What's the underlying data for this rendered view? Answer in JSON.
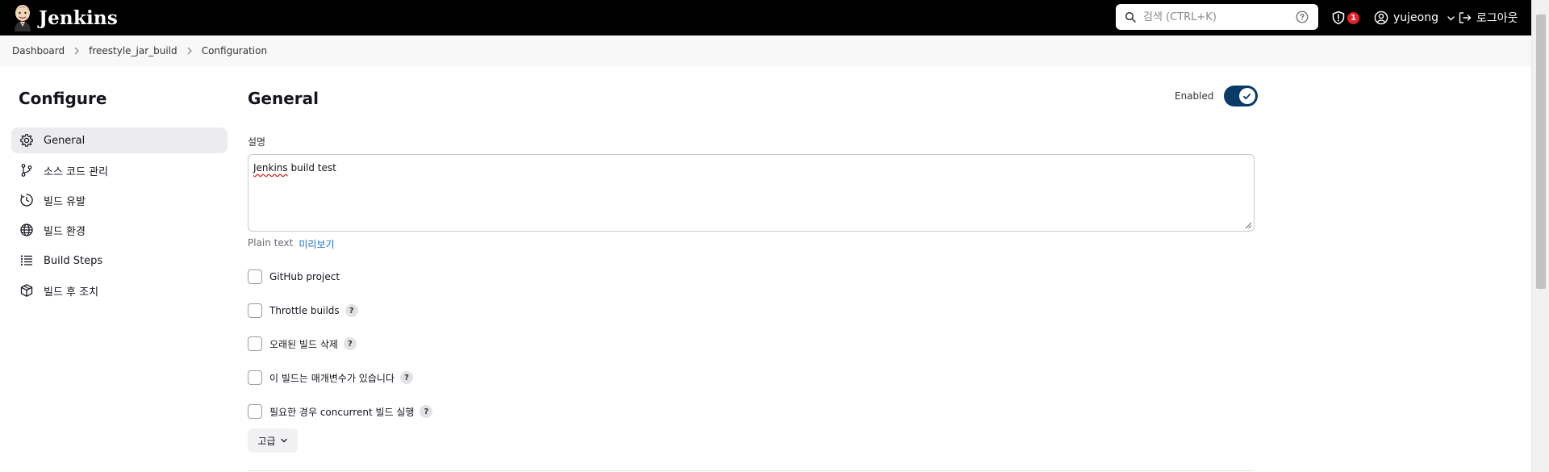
{
  "header": {
    "brand": "Jenkins",
    "search_placeholder": "검색 (CTRL+K)",
    "security_count": "1",
    "username": "yujeong",
    "logout_label": "로그아웃"
  },
  "breadcrumb": {
    "items": [
      "Dashboard",
      "freestyle_jar_build",
      "Configuration"
    ]
  },
  "sidebar": {
    "title": "Configure",
    "items": [
      {
        "label": "General",
        "icon": "gear-icon"
      },
      {
        "label": "소스 코드 관리",
        "icon": "branch-icon"
      },
      {
        "label": "빌드 유발",
        "icon": "clock-icon"
      },
      {
        "label": "빌드 환경",
        "icon": "globe-icon"
      },
      {
        "label": "Build Steps",
        "icon": "list-icon"
      },
      {
        "label": "빌드 후 조치",
        "icon": "cube-icon"
      }
    ]
  },
  "main": {
    "section_title": "General",
    "enabled_label": "Enabled",
    "enabled": true,
    "description_label": "설명",
    "description_word1": "Jenkins",
    "description_rest": " build test",
    "plain_text_label": "Plain text",
    "preview_label": "미리보기",
    "options": [
      {
        "label": "GitHub project",
        "help": false,
        "checked": false
      },
      {
        "label": "Throttle builds",
        "help": true,
        "checked": false
      },
      {
        "label": "오래된 빌드 삭제",
        "help": true,
        "checked": false
      },
      {
        "label": "이 빌드는 매개변수가 있습니다",
        "help": true,
        "checked": false
      },
      {
        "label": "필요한 경우 concurrent 빌드 실행",
        "help": true,
        "checked": false
      }
    ],
    "help_glyph": "?",
    "advanced_label": "고급"
  },
  "colors": {
    "header_bg": "#000000",
    "toggle_on": "#0b3b68",
    "link": "#1a6fd0",
    "badge": "#e62226"
  }
}
